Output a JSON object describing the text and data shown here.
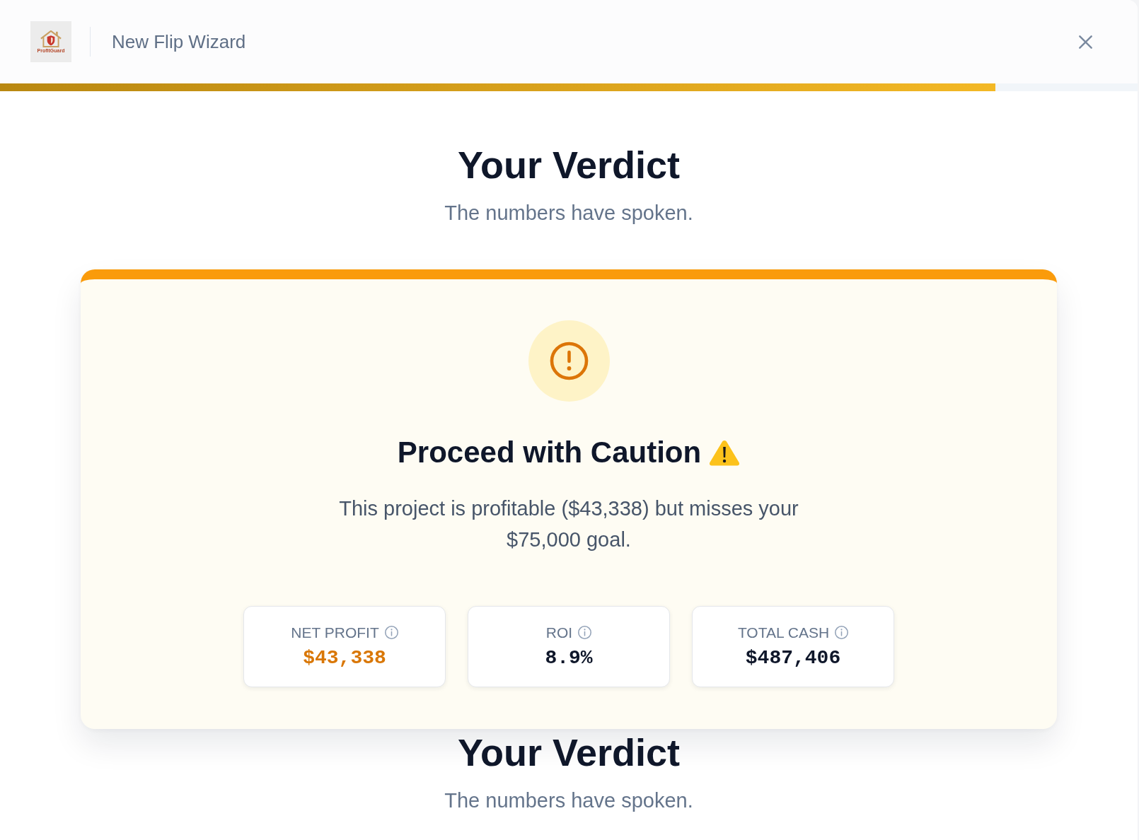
{
  "header": {
    "brand": "ProfitGuard",
    "title": "New Flip Wizard"
  },
  "progress": {
    "level": 0.875
  },
  "intro": {
    "title": "Your Verdict",
    "subtitle": "The numbers have spoken."
  },
  "verdict": {
    "kind": "caution",
    "title": "Proceed with Caution",
    "message": "This project is profitable ($43,338) but misses your $75,000 goal.",
    "metrics": [
      {
        "label": "NET PROFIT",
        "value": "$43,338",
        "color": "#d97706"
      },
      {
        "label": "ROI",
        "value": "8.9%",
        "color": "#0f172a"
      },
      {
        "label": "TOTAL CASH",
        "value": "$487,406",
        "color": "#0f172a"
      }
    ]
  },
  "next_section": {
    "title": "Your Verdict",
    "subtitle": "The numbers have spoken."
  }
}
